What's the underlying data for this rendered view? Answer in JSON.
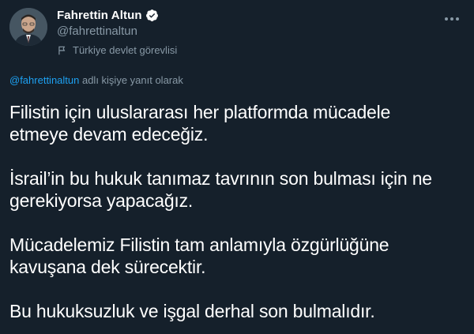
{
  "author": {
    "display_name": "Fahrettin Altun",
    "handle": "@fahrettinaltun",
    "label": "Türkiye devlet görevlisi",
    "verified": true
  },
  "reply_context": {
    "mention": "@fahrettinaltun",
    "suffix": " adlı kişiye yanıt olarak"
  },
  "tweet": {
    "paragraphs": [
      "Filistin için uluslararası her platformda mücadele\netmeye devam edeceğiz.",
      "İsrail’in bu hukuk tanımaz tavrının son bulması için ne\ngerekiyorsa yapacağız.",
      "Mücadelemiz Filistin tam anlamıyla özgürlüğüne\nkavuşana dek sürecektir.",
      "Bu hukuksuzluk ve işgal derhal son bulmalıdır."
    ]
  },
  "icons": {
    "verified": "verified-badge-icon",
    "flag": "flag-icon",
    "more": "more-options-icon"
  },
  "colors": {
    "background": "#15202b",
    "accent": "#1da1f2",
    "secondary_text": "#8899a6"
  }
}
